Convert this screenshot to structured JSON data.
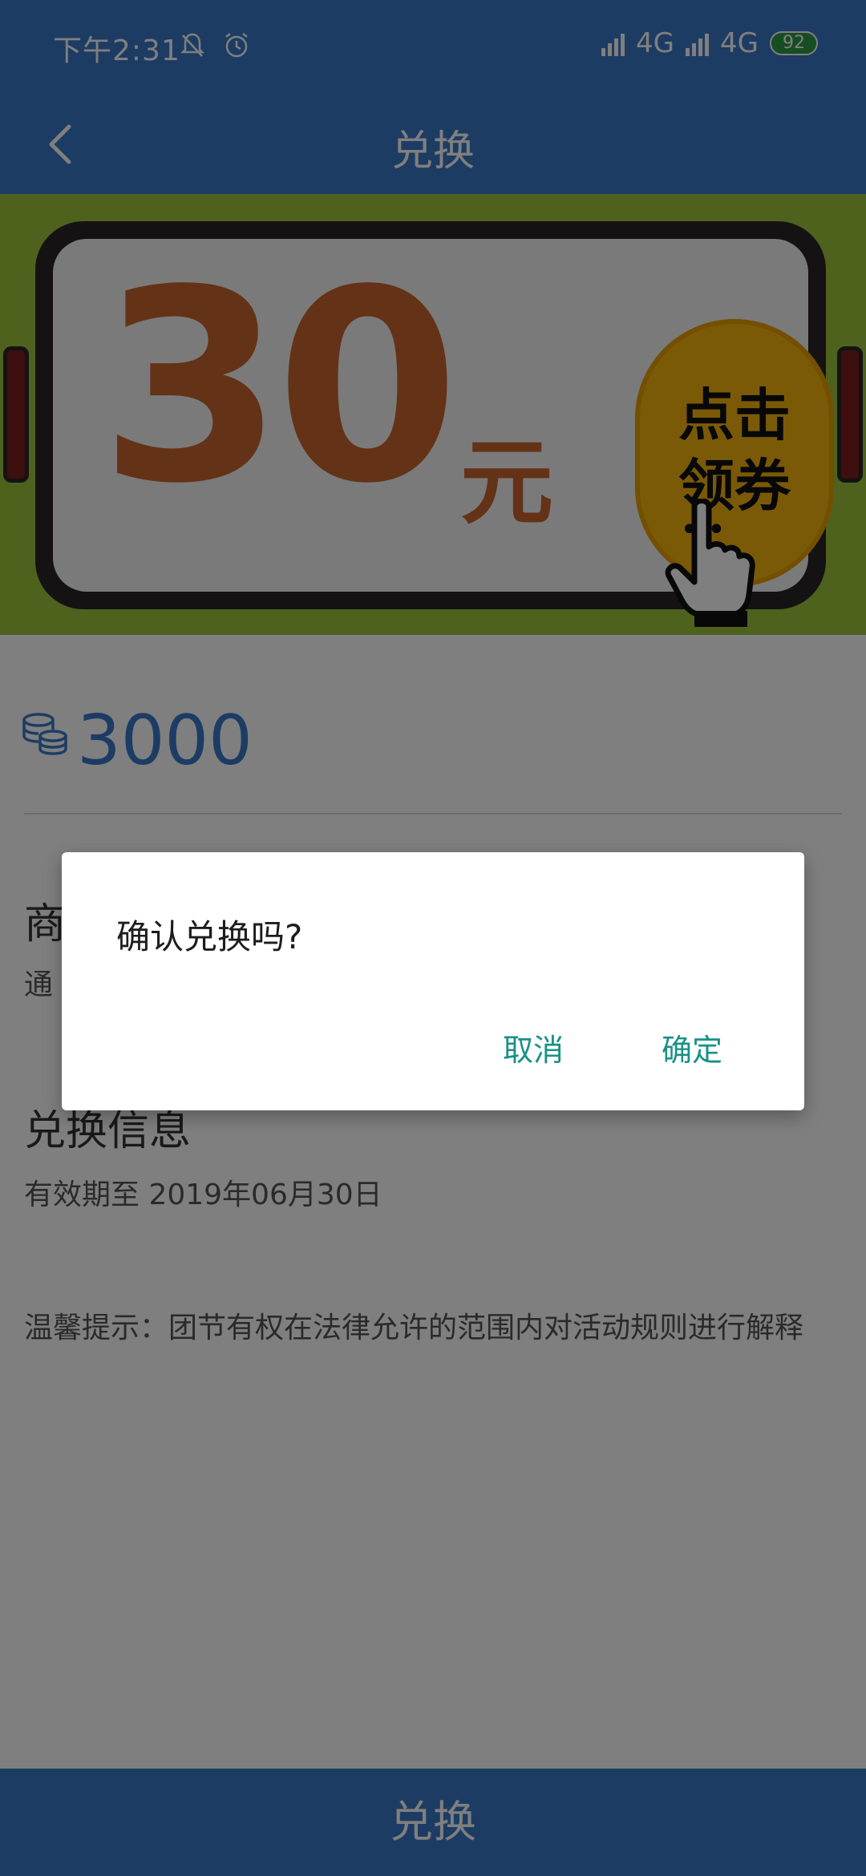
{
  "status_bar": {
    "time": "下午2:31",
    "network_1": "4G",
    "network_2": "4G",
    "battery": "92"
  },
  "app_bar": {
    "title": "兑换"
  },
  "banner": {
    "amount": "30",
    "unit": "元",
    "cta_line1": "点击",
    "cta_line2": "领券"
  },
  "points": {
    "value": "3000"
  },
  "product": {
    "title_partial": "商",
    "desc_partial": "通"
  },
  "exchange_info": {
    "title": "兑换信息",
    "validity": "有效期至 2019年06月30日",
    "notice": "温馨提示：团节有权在法律允许的范围内对活动规则进行解释"
  },
  "bottom_button": {
    "label": "兑换"
  },
  "dialog": {
    "message": "确认兑换吗?",
    "cancel_label": "取消",
    "confirm_label": "确定"
  },
  "colors": {
    "primary": "#3a78c9",
    "dialog_button": "#199184",
    "banner_bg": "#9dc43c",
    "coupon_text": "#c9652e"
  },
  "icons": [
    "mute-bell-icon",
    "alarm-icon",
    "signal-icon",
    "back-chevron-icon",
    "coin-stack-icon",
    "pointing-hand-icon"
  ]
}
